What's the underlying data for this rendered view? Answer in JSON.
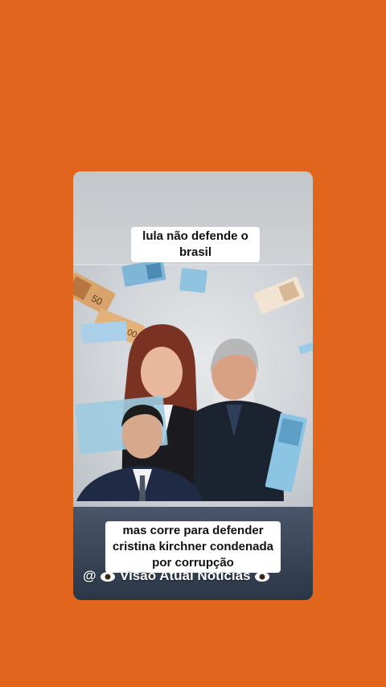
{
  "caption_top": "lula não defende o brasil",
  "caption_bottom": "mas corre para defender cristina kirchner condenada por corrupção",
  "watermark": {
    "prefix": "@",
    "text": "Visão Atual Notícias"
  },
  "colors": {
    "background": "#e2651e",
    "caption_bg": "#ffffff",
    "caption_text": "#111111"
  },
  "icons": [
    "eye-icon",
    "eye-icon"
  ]
}
